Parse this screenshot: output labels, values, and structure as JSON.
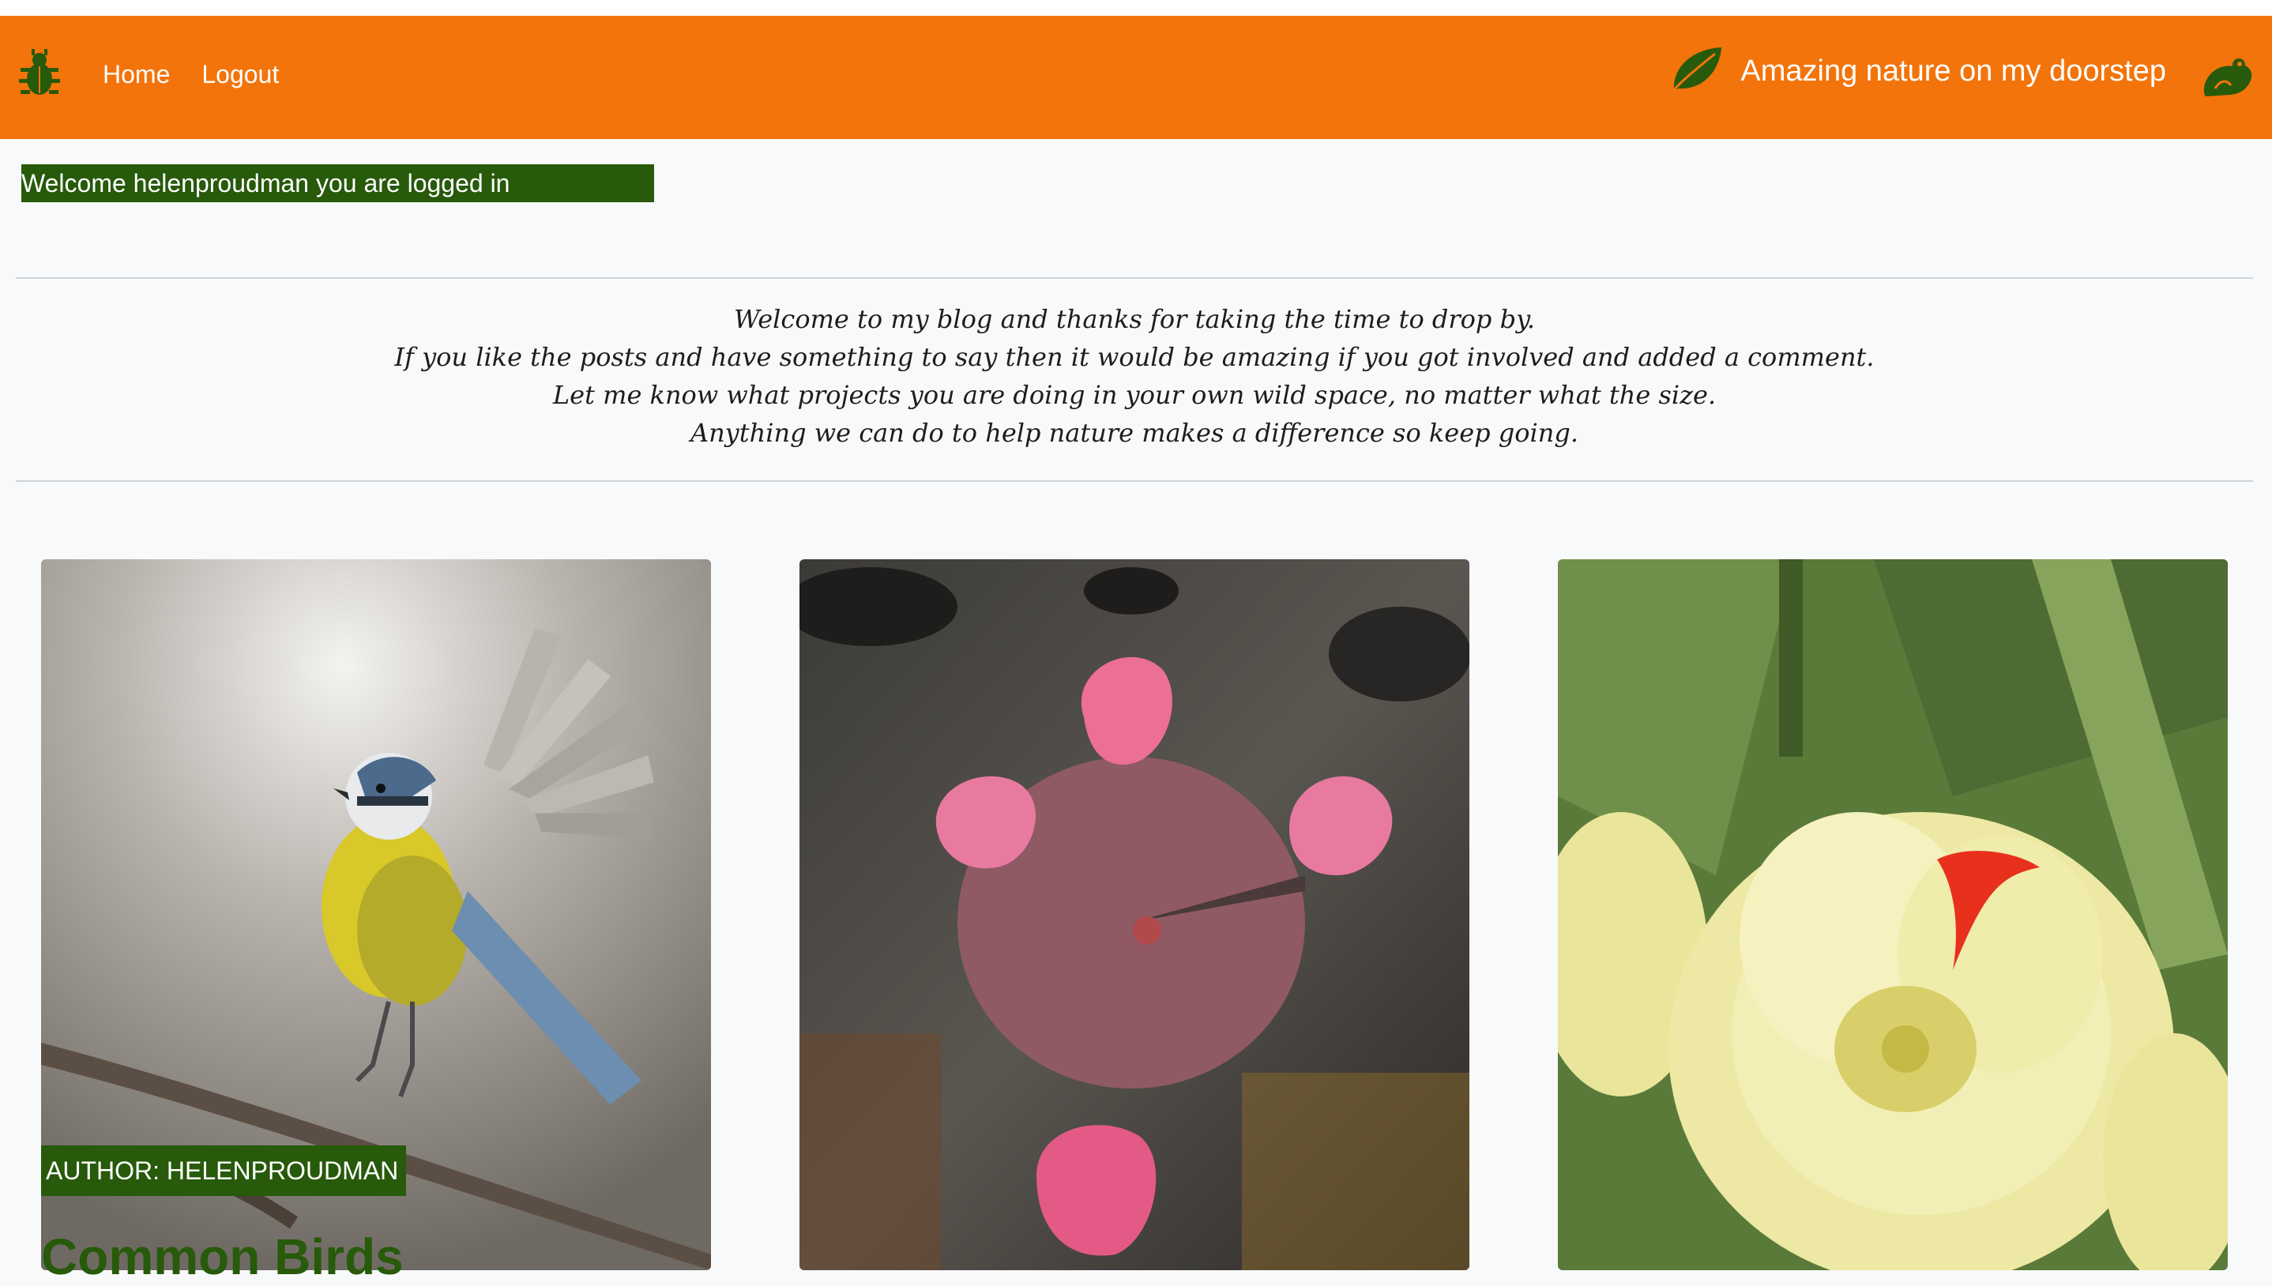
{
  "nav": {
    "home_label": "Home",
    "logout_label": "Logout",
    "brand_title": "Amazing nature on my doorstep",
    "bug_icon": "bug-icon",
    "leaf_icon": "leaf-icon",
    "frog_icon": "frog-icon"
  },
  "welcome": {
    "message": "Welcome helenproudman you are logged in"
  },
  "intro": {
    "lines": [
      "Welcome to my blog and thanks for taking the time to drop by.",
      "If you like the posts and have something to say then it would be amazing if you got involved and added a comment.",
      "Let me know what projects you are doing in your own wild space, no matter what the size.",
      "Anything we can do to help nature makes a difference so keep going."
    ]
  },
  "posts": [
    {
      "author_badge": "AUTHOR: HELENPROUDMAN",
      "title_partial": "Common Birds",
      "image": "blue-tit-photo"
    },
    {
      "image": "water-lily-photo"
    },
    {
      "image": "yellow-tulip-photo"
    }
  ],
  "colors": {
    "navbar": "#f3740b",
    "accent_green": "#275a0a",
    "background": "#f8f9fb"
  }
}
